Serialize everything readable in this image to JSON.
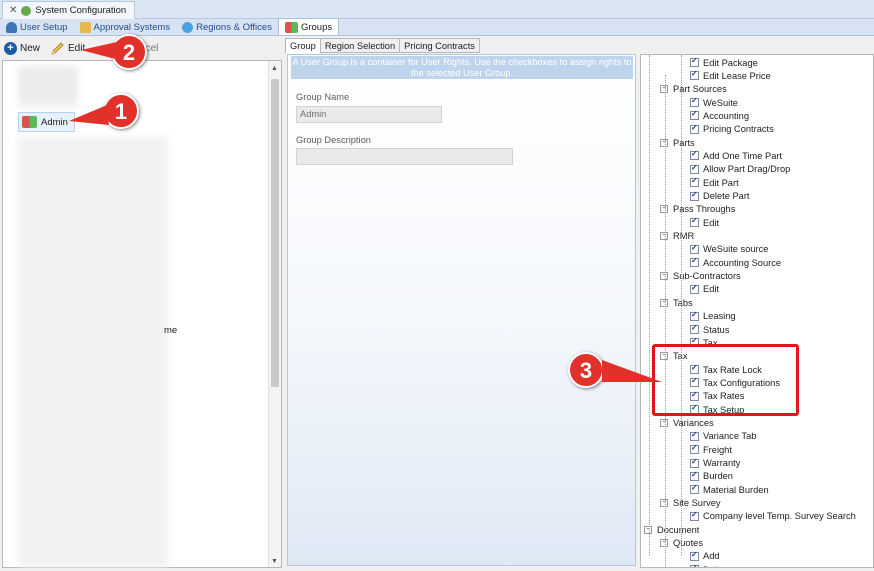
{
  "window": {
    "title": "System Configuration"
  },
  "module_tabs": [
    {
      "label": "User Setup",
      "icon": "user-icon"
    },
    {
      "label": "Approval Systems",
      "icon": "approval-icon"
    },
    {
      "label": "Regions & Offices",
      "icon": "globe-icon"
    },
    {
      "label": "Groups",
      "icon": "groups-icon",
      "active": true
    }
  ],
  "toolbar": {
    "new_label": "New",
    "edit_label": "Edit",
    "cancel_label": "Cancel"
  },
  "left_list": {
    "selected_item": "Admin",
    "truncated_text": "me"
  },
  "right_tabs": [
    "Group",
    "Region Selection",
    "Pricing Contracts"
  ],
  "group_form": {
    "info": "A User Group is a container for User Rights. Use the checkboxes to assign rights to the selected User Group.",
    "name_label": "Group Name",
    "name_value": "Admin",
    "description_label": "Group Description",
    "description_value": ""
  },
  "rights_tree": [
    {
      "label": "Edit Package",
      "level": 3,
      "checked": true
    },
    {
      "label": "Edit Lease Price",
      "level": 3,
      "checked": true
    },
    {
      "label": "Part Sources",
      "level": 2,
      "expander": true
    },
    {
      "label": "WeSuite",
      "level": 3,
      "checked": true
    },
    {
      "label": "Accounting",
      "level": 3,
      "checked": true
    },
    {
      "label": "Pricing Contracts",
      "level": 3,
      "checked": true
    },
    {
      "label": "Parts",
      "level": 2,
      "expander": true
    },
    {
      "label": "Add One Time Part",
      "level": 3,
      "checked": true
    },
    {
      "label": "Allow Part Drag/Drop",
      "level": 3,
      "checked": true
    },
    {
      "label": "Edit Part",
      "level": 3,
      "checked": true
    },
    {
      "label": "Delete Part",
      "level": 3,
      "checked": true
    },
    {
      "label": "Pass Throughs",
      "level": 2,
      "expander": true
    },
    {
      "label": "Edit",
      "level": 3,
      "checked": true
    },
    {
      "label": "RMR",
      "level": 2,
      "expander": true
    },
    {
      "label": "WeSuite source",
      "level": 3,
      "checked": true
    },
    {
      "label": "Accounting Source",
      "level": 3,
      "checked": true
    },
    {
      "label": "Sub-Contractors",
      "level": 2,
      "expander": true
    },
    {
      "label": "Edit",
      "level": 3,
      "checked": true
    },
    {
      "label": "Tabs",
      "level": 2,
      "expander": true
    },
    {
      "label": "Leasing",
      "level": 3,
      "checked": true
    },
    {
      "label": "Status",
      "level": 3,
      "checked": true
    },
    {
      "label": "Tax",
      "level": 3,
      "checked": true
    },
    {
      "label": "Tax",
      "level": 2,
      "expander": true
    },
    {
      "label": "Tax Rate Lock",
      "level": 3,
      "checked": true
    },
    {
      "label": "Tax Configurations",
      "level": 3,
      "checked": true
    },
    {
      "label": "Tax Rates",
      "level": 3,
      "checked": true
    },
    {
      "label": "Tax Setup",
      "level": 3,
      "checked": true
    },
    {
      "label": "Variances",
      "level": 2,
      "expander": true
    },
    {
      "label": "Variance Tab",
      "level": 3,
      "checked": true
    },
    {
      "label": "Freight",
      "level": 3,
      "checked": true
    },
    {
      "label": "Warranty",
      "level": 3,
      "checked": true
    },
    {
      "label": "Burden",
      "level": 3,
      "checked": true
    },
    {
      "label": "Material Burden",
      "level": 3,
      "checked": true
    },
    {
      "label": "Site Survey",
      "level": 2,
      "expander": true
    },
    {
      "label": "Company level Temp. Survey Search",
      "level": 3,
      "checked": true
    },
    {
      "label": "Document",
      "level": 1,
      "expander": true
    },
    {
      "label": "Quotes",
      "level": 2,
      "expander": true
    },
    {
      "label": "Add",
      "level": 3,
      "checked": true
    },
    {
      "label": "Delete",
      "level": 3,
      "checked": true
    }
  ],
  "callouts": [
    "1",
    "2",
    "3"
  ],
  "colors": {
    "callout": "#e0312b",
    "highlight_box": "#e0161c",
    "accent": "#1c5aa6"
  }
}
